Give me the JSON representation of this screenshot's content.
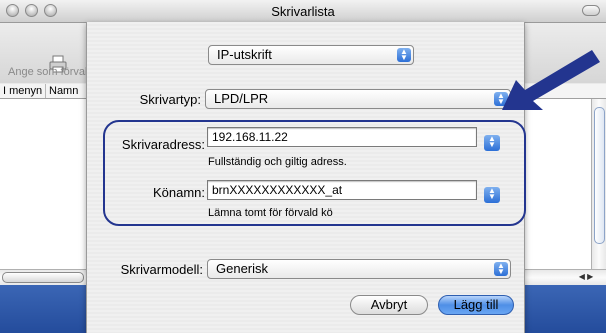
{
  "window": {
    "title": "Skrivarlista",
    "toolbar_label": "Ange som förvald",
    "column_headers": [
      "I menyn",
      "Namn"
    ]
  },
  "sheet": {
    "connection_popup": "IP-utskrift",
    "printer_type_label": "Skrivartyp:",
    "printer_type_value": "LPD/LPR",
    "address_label": "Skrivaradress:",
    "address_value": "192.168.11.22",
    "address_hint": "Fullständig och giltig adress.",
    "queue_label": "Könamn:",
    "queue_value": "brnXXXXXXXXXXXX_at",
    "queue_hint": "Lämna tomt för förvald kö",
    "model_label": "Skrivarmodell:",
    "model_value": "Generisk",
    "cancel_label": "Avbryt",
    "add_label": "Lägg till"
  },
  "colors": {
    "callout_arrow": "#23358f",
    "default_button": "#4f8fe6"
  },
  "icons": [
    "printer-icon",
    "stepper-icon",
    "callout-arrow-icon"
  ]
}
